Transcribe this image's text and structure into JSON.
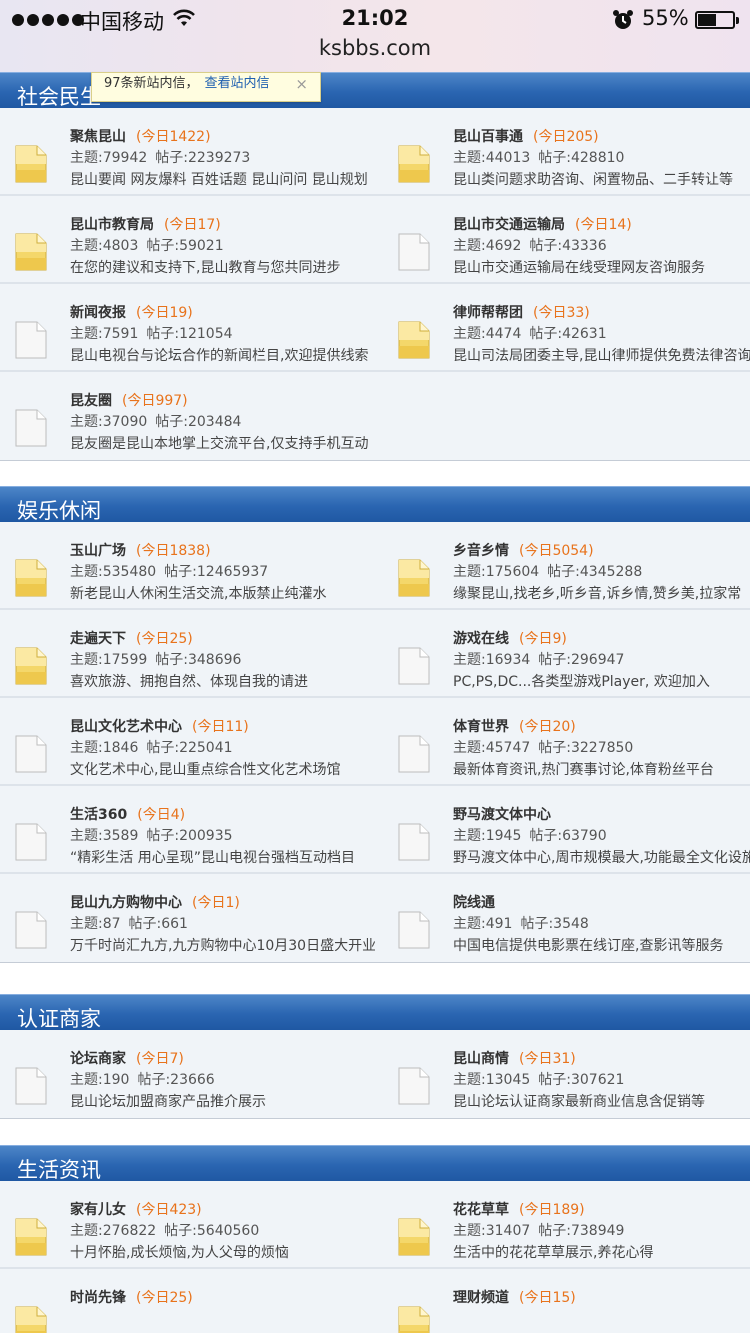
{
  "status_bar": {
    "carrier": "中国移动",
    "time": "21:02",
    "battery": "55%",
    "battery_level": 0.55
  },
  "browser": {
    "url": "ksbbs.com"
  },
  "notice": {
    "text": "97条新站内信，",
    "link": "查看站内信",
    "close": "×"
  },
  "sections": [
    {
      "title": "社会民生",
      "forums": [
        {
          "name": "聚焦昆山",
          "today": "(今日1422)",
          "topics": "主题:79942",
          "posts": "帖子:2239273",
          "desc": "昆山要闻 网友爆料 百姓话题 昆山问问 昆山规划",
          "icon": "new-posts-folder-icon"
        },
        {
          "name": "昆山百事通",
          "today": "(今日205)",
          "topics": "主题:44013",
          "posts": "帖子:428810",
          "desc": "昆山类问题求助咨询、闲置物品、二手转让等",
          "icon": "new-posts-folder-icon"
        },
        {
          "name": "昆山市教育局",
          "today": "(今日17)",
          "topics": "主题:4803",
          "posts": "帖子:59021",
          "desc": "在您的建议和支持下,昆山教育与您共同进步",
          "icon": "new-posts-folder-icon"
        },
        {
          "name": "昆山市交通运输局",
          "today": "(今日14)",
          "topics": "主题:4692",
          "posts": "帖子:43336",
          "desc": "昆山市交通运输局在线受理网友咨询服务",
          "icon": "no-new-posts-folder-icon"
        },
        {
          "name": "新闻夜报",
          "today": "(今日19)",
          "topics": "主题:7591",
          "posts": "帖子:121054",
          "desc": "昆山电视台与论坛合作的新闻栏目,欢迎提供线索",
          "icon": "no-new-posts-folder-icon"
        },
        {
          "name": "律师帮帮团",
          "today": "(今日33)",
          "topics": "主题:4474",
          "posts": "帖子:42631",
          "desc": "昆山司法局团委主导,昆山律师提供免费法律咨询",
          "icon": "new-posts-folder-icon"
        },
        {
          "name": "昆友圈",
          "today": "(今日997)",
          "topics": "主题:37090",
          "posts": "帖子:203484",
          "desc": "昆友圈是昆山本地掌上交流平台,仅支持手机互动",
          "icon": "no-new-posts-folder-icon"
        }
      ]
    },
    {
      "title": "娱乐休闲",
      "forums": [
        {
          "name": "玉山广场",
          "today": "(今日1838)",
          "topics": "主题:535480",
          "posts": "帖子:12465937",
          "desc": "新老昆山人休闲生活交流,本版禁止纯灌水",
          "icon": "new-posts-folder-icon"
        },
        {
          "name": "乡音乡情",
          "today": "(今日5054)",
          "topics": "主题:175604",
          "posts": "帖子:4345288",
          "desc": "缘聚昆山,找老乡,听乡音,诉乡情,赞乡美,拉家常",
          "icon": "new-posts-folder-icon"
        },
        {
          "name": "走遍天下",
          "today": "(今日25)",
          "topics": "主题:17599",
          "posts": "帖子:348696",
          "desc": "喜欢旅游、拥抱自然、体现自我的请进",
          "icon": "new-posts-folder-icon"
        },
        {
          "name": "游戏在线",
          "today": "(今日9)",
          "topics": "主题:16934",
          "posts": "帖子:296947",
          "desc": "PC,PS,DC...各类型游戏Player, 欢迎加入",
          "icon": "no-new-posts-folder-icon"
        },
        {
          "name": "昆山文化艺术中心",
          "today": "(今日11)",
          "topics": "主题:1846",
          "posts": "帖子:225041",
          "desc": "文化艺术中心,昆山重点综合性文化艺术场馆",
          "icon": "no-new-posts-folder-icon"
        },
        {
          "name": "体育世界",
          "today": "(今日20)",
          "topics": "主题:45747",
          "posts": "帖子:3227850",
          "desc": "最新体育资讯,热门赛事讨论,体育粉丝平台",
          "icon": "no-new-posts-folder-icon"
        },
        {
          "name": "生活360",
          "today": "(今日4)",
          "topics": "主题:3589",
          "posts": "帖子:200935",
          "desc": "“精彩生活 用心呈现”昆山电视台强档互动档目",
          "icon": "no-new-posts-folder-icon"
        },
        {
          "name": "野马渡文体中心",
          "today": "",
          "topics": "主题:1945",
          "posts": "帖子:63790",
          "desc": "野马渡文体中心,周市规模最大,功能最全文化设施",
          "icon": "no-new-posts-folder-icon"
        },
        {
          "name": "昆山九方购物中心",
          "today": "(今日1)",
          "topics": "主题:87",
          "posts": "帖子:661",
          "desc": "万千时尚汇九方,九方购物中心10月30日盛大开业",
          "icon": "no-new-posts-folder-icon"
        },
        {
          "name": "院线通",
          "today": "",
          "topics": "主题:491",
          "posts": "帖子:3548",
          "desc": "中国电信提供电影票在线订座,查影讯等服务",
          "icon": "no-new-posts-folder-icon"
        }
      ]
    },
    {
      "title": "认证商家",
      "forums": [
        {
          "name": "论坛商家",
          "today": "(今日7)",
          "topics": "主题:190",
          "posts": "帖子:23666",
          "desc": "昆山论坛加盟商家产品推介展示",
          "icon": "no-new-posts-folder-icon"
        },
        {
          "name": "昆山商情",
          "today": "(今日31)",
          "topics": "主题:13045",
          "posts": "帖子:307621",
          "desc": "昆山论坛认证商家最新商业信息含促销等",
          "icon": "no-new-posts-folder-icon"
        }
      ]
    },
    {
      "title": "生活资讯",
      "forums": [
        {
          "name": "家有儿女",
          "today": "(今日423)",
          "topics": "主题:276822",
          "posts": "帖子:5640560",
          "desc": "十月怀胎,成长烦恼,为人父母的烦恼",
          "icon": "new-posts-folder-icon"
        },
        {
          "name": "花花草草",
          "today": "(今日189)",
          "topics": "主题:31407",
          "posts": "帖子:738949",
          "desc": "生活中的花花草草展示,养花心得",
          "icon": "new-posts-folder-icon"
        },
        {
          "name": "时尚先锋",
          "today": "(今日25)",
          "topics": "",
          "posts": "",
          "desc": "",
          "icon": "new-posts-folder-icon"
        },
        {
          "name": "理财频道",
          "today": "(今日15)",
          "topics": "",
          "posts": "",
          "desc": "",
          "icon": "new-posts-folder-icon"
        }
      ]
    }
  ]
}
